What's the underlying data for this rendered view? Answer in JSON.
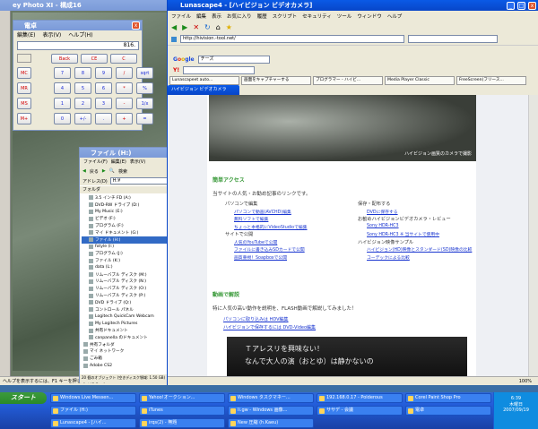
{
  "photo": {
    "title": "ey Photo XI - 構成16"
  },
  "calc": {
    "title": "電卓",
    "menu": [
      "編集(E)",
      "表示(V)",
      "ヘルプ(H)"
    ],
    "display": "816.",
    "top": [
      "Back",
      "CE",
      "C"
    ],
    "rows": [
      [
        "MC",
        "7",
        "8",
        "9",
        "/",
        "sqrt"
      ],
      [
        "MR",
        "4",
        "5",
        "6",
        "*",
        "%"
      ],
      [
        "MS",
        "1",
        "2",
        "3",
        "-",
        "1/x"
      ],
      [
        "M+",
        "0",
        "+/-",
        ".",
        "+",
        "="
      ]
    ]
  },
  "files": {
    "title": "ファイル (H:)",
    "menu": [
      "ファイル(F)",
      "編集(E)",
      "表示(V)"
    ],
    "back": "戻る",
    "search": "検索",
    "address_label": "アドレス(D)",
    "address": "H:¥",
    "folder_label": "フォルダ",
    "tree": [
      "3.5 インチ FD (A:)",
      "DVD-RW ドライブ (D:)",
      "My Music (E:)",
      "ビデオ (F:)",
      "プログラム (F:)",
      "マイ ドキュメント (G:)",
      "ファイル (H:)",
      "fotyle (I:)",
      "プログラム (J:)",
      "ファイル (K:)",
      "data (L:)",
      "リムーバブル ディスク (M:)",
      "リムーバブル ディスク (N:)",
      "リムーバブル ディスク (O:)",
      "リムーバブル ディスク (P:)",
      "DVD ドライブ (Q:)",
      "コントロール パネル",
      "Logitech QuickCam Webcam",
      "My Logitech Pictures",
      "共有ドキュメント",
      "canpanella のドキュメント",
      "共有フォルダ",
      "マイ ネットワーク",
      "ごみ箱",
      "Adobe CS2"
    ],
    "status": "20 個のオブジェクト (空きディスク領域: 1.50 GB)"
  },
  "browser": {
    "title": "Lunascape4 - [ハイビジョン ビデオカメラ]",
    "menu": [
      "ファイル",
      "編集",
      "表示",
      "お気に入り",
      "履歴",
      "スクリプト",
      "セキュリティ",
      "ツール",
      "ウィンドウ",
      "ヘルプ"
    ],
    "url": "http://hivision.-tool.net/",
    "tabs": [
      "Lunascapeet auto...",
      "画面をキャプチャーする",
      "プログラマー - ハイビ...",
      "Media Player Classic",
      "FreeScreen(フリース..."
    ],
    "active_tab": "ハイビジョン ビデオカメラ",
    "search_box": "チーズ",
    "bookmarks": [
      "ブックマーク"
    ],
    "photo_caption": "ハイビジョン画質のカメラで撮影",
    "sec1": "簡単アクセス",
    "intro": "当サイトの人気・お勧め記事のリンクです。",
    "colL": [
      {
        "h": "パソコンで編集",
        "items": [
          "パソコンで動画(AVCHD)編集",
          "無料ソフトで編集",
          "ちょっと本格的にVideoStudioで編集"
        ]
      },
      {
        "h": "サイトで公開",
        "items": [
          "人気のYouTubeで公開",
          "ファイルに書き込みSDカードで公開",
          "画質重視！Soapboxで公開"
        ]
      }
    ],
    "colR": [
      {
        "h": "保存・配布する",
        "items": [
          "DVDに保存する"
        ]
      },
      {
        "h": "お勧めハイビジョンビデオカメラ・レビュー",
        "items": [
          "Sony HDR-HC3",
          "Sony HDR-HC3 ※ 当サイトで使用中"
        ]
      },
      {
        "h": "ハイビジョン映像サンプル",
        "items": [
          "ハイビジョン(HD)映像とスタンダード(SD)映像の比較",
          "コーデックによる比較"
        ]
      }
    ],
    "sec2": "動画で解説",
    "sec2_text": "特に人気の高い動作を説明を、FLASH動画で解説してみました！",
    "sec2_items": [
      "パソコンに取り込みは HDV編集",
      "ハイビジョンで保存するには DVD-Video編集"
    ],
    "video_text1": "Ｔアレスリを興味ない！",
    "video_text2": "なんで大人の演（おとゆ）は静かないの",
    "zoom": "100%"
  },
  "taskbar": {
    "start": "スタート",
    "row1": [
      "Windows Live Messen...",
      "Yahoo!オークション...",
      "Windows タスクマネー...",
      "192.168.0.17 - Polderous",
      "Corel Paint Shop Pro"
    ],
    "row2": [
      "ファイル (H:)",
      "iTunes",
      "Ii.gw - Windows 画像...",
      "ササデ - 会議",
      "電卓"
    ],
    "row3": [
      "Lunascape4 - [ハイ...",
      "irqs(2) - 無題",
      "New 圧縮 (h.Kaeu)"
    ],
    "time": "6:39",
    "weekday": "木曜日",
    "date": "2007/09/19"
  }
}
